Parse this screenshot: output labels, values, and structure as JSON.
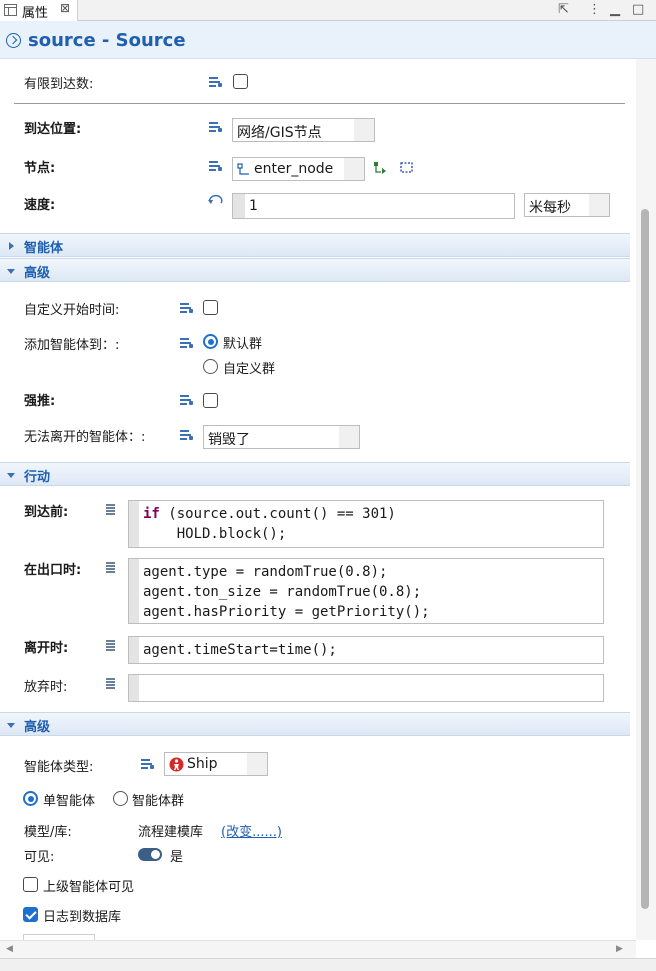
{
  "tab": {
    "label": "属性",
    "close": "⊠"
  },
  "header": {
    "title": "source - Source"
  },
  "top": {
    "limited_arrivals_label": "有限到达数:",
    "arrival_location_label": "到达位置:",
    "arrival_location_value": "网络/GIS节点",
    "node_label": "节点:",
    "node_value": "enter_node",
    "speed_label": "速度:",
    "speed_value": "1",
    "speed_unit": "米每秒"
  },
  "sections": {
    "agent": "智能体",
    "advanced": "高级",
    "actions": "行动",
    "advanced2": "高级"
  },
  "advanced": {
    "custom_start_label": "自定义开始时间:",
    "add_agents_label": "添加智能体到：:",
    "default_pop": "默认群",
    "custom_pop": "自定义群",
    "force_push_label": "强推:",
    "cannot_exit_label": "无法离开的智能体：:",
    "cannot_exit_value": "销毁了"
  },
  "actions": {
    "on_before_arrival_label": "到达前:",
    "on_before_arrival_code": [
      "if (source.out.count() == 301)",
      "    HOLD.block();"
    ],
    "on_at_exit_label": "在出口时:",
    "on_at_exit_code": [
      "agent.type = randomTrue(0.8);",
      "agent.ton_size = randomTrue(0.8);",
      "agent.hasPriority = getPriority();"
    ],
    "on_exit_label": "离开时:",
    "on_exit_code": [
      "agent.timeStart=time();"
    ],
    "on_discard_label": "放弃时:",
    "on_discard_code": []
  },
  "advanced2": {
    "agent_type_label": "智能体类型:",
    "agent_type_value": "Ship",
    "single_agent": "单智能体",
    "agent_population": "智能体群",
    "model_label": "模型/库:",
    "model_value": "流程建模库",
    "change_link": "(改变......)",
    "visible_label": "可见:",
    "visible_value": "是",
    "upper_visible": "上级智能体可见",
    "log_to_db": "日志到数据库"
  }
}
